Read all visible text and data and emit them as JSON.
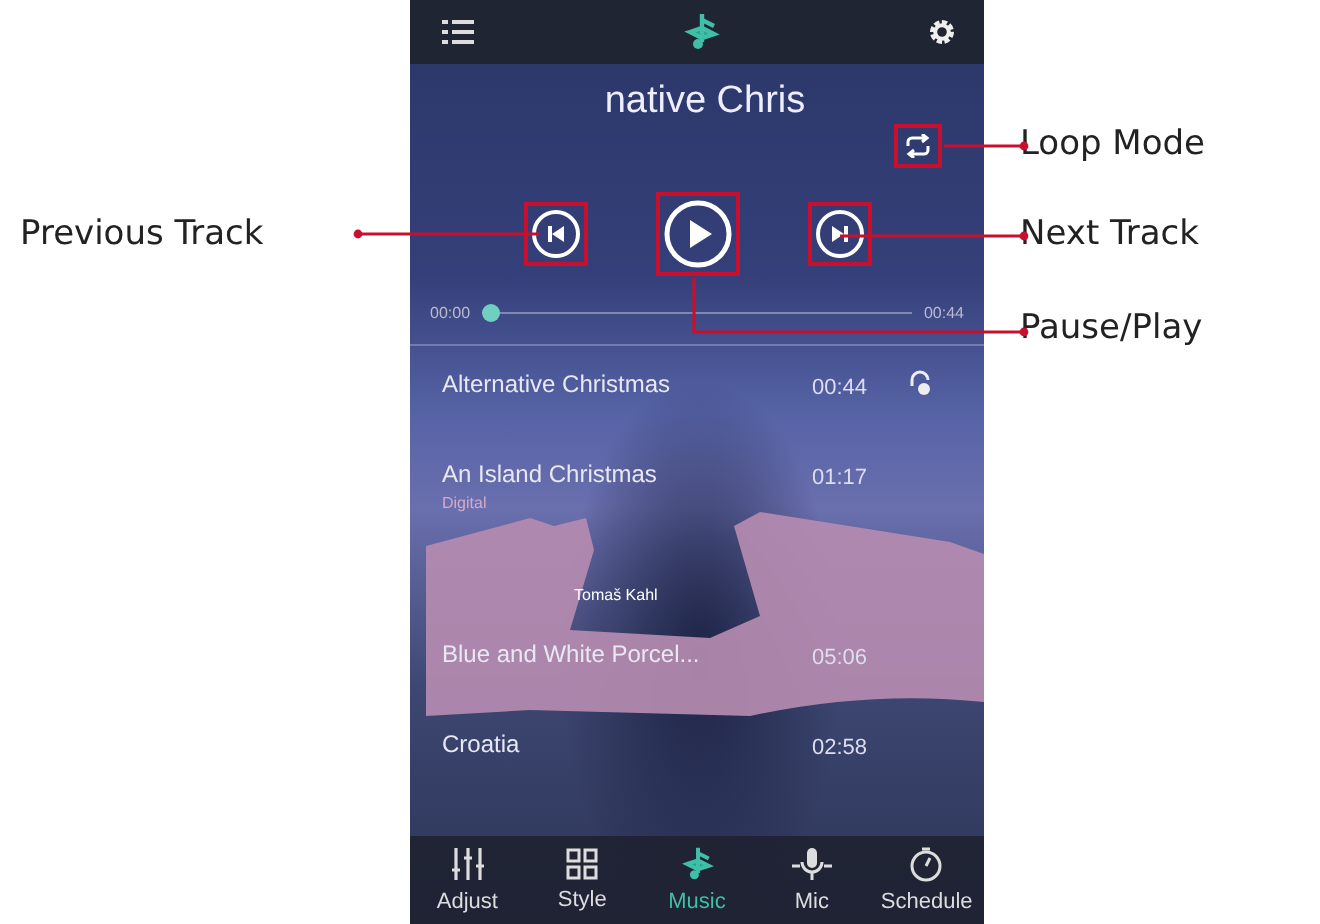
{
  "callouts": {
    "left": [
      {
        "label": "Previous Track"
      }
    ],
    "right": [
      {
        "label": "Loop Mode"
      },
      {
        "label": "Next Track"
      },
      {
        "label": "Pause/Play"
      }
    ]
  },
  "now_playing": {
    "title": "native Chris"
  },
  "progress": {
    "elapsed": "00:00",
    "total": "00:44",
    "level": 0
  },
  "tracks": [
    {
      "title": "Alternative Christmas",
      "duration": "00:44",
      "playing": true
    },
    {
      "title": "An Island Christmas",
      "duration": "01:17",
      "subtitle": "Digital",
      "playing": false
    },
    {
      "kind": "redacted",
      "caption": "Tomaš Kahl"
    },
    {
      "title": "Blue and White Porcel...",
      "duration": "05:06",
      "playing": false
    },
    {
      "title": "Croatia",
      "duration": "02:58",
      "playing": false
    }
  ],
  "nav": [
    {
      "label": "Adjust",
      "kind": "sliders",
      "selected": false
    },
    {
      "label": "Style",
      "kind": "grid",
      "selected": false
    },
    {
      "label": "Music",
      "kind": "note",
      "selected": true
    },
    {
      "label": "Mic",
      "kind": "mic",
      "selected": false
    },
    {
      "label": "Schedule",
      "kind": "timer",
      "selected": false
    }
  ]
}
